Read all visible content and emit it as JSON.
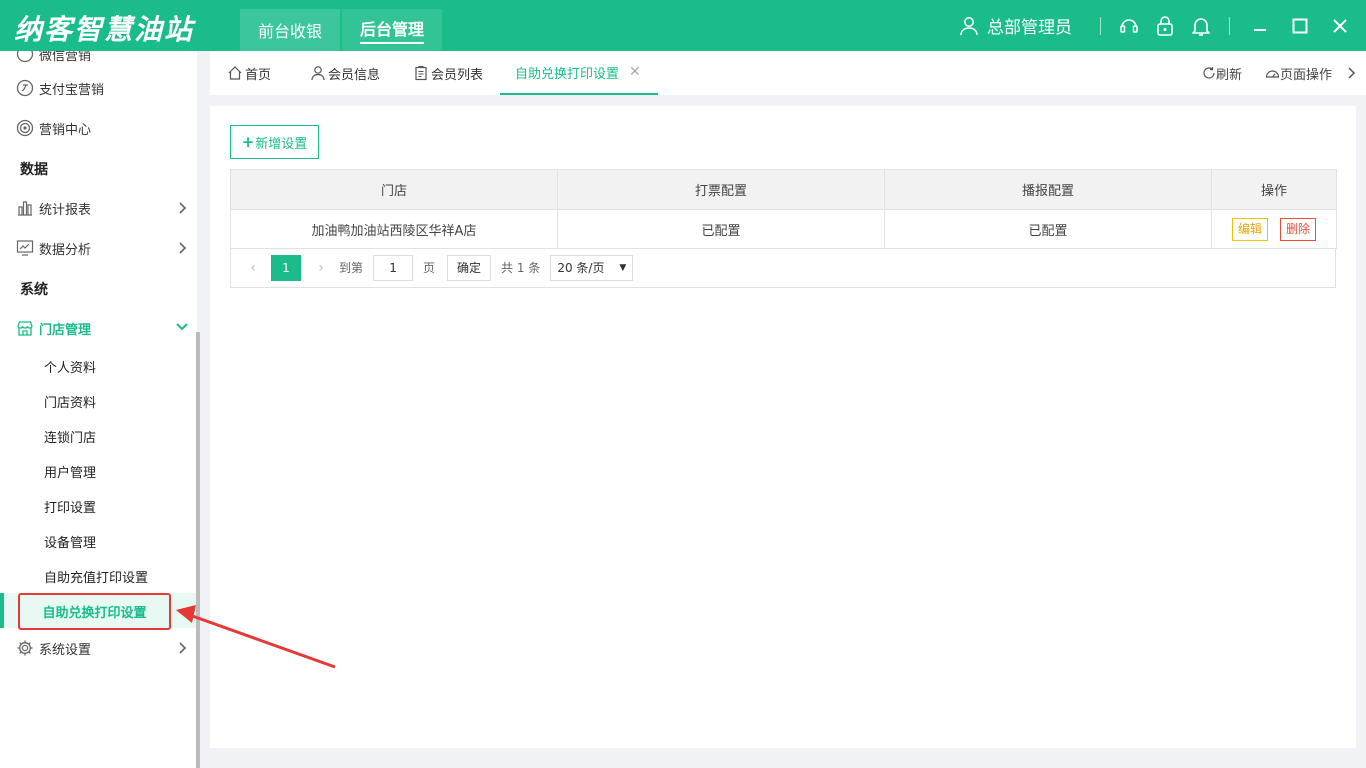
{
  "app": {
    "logo": "纳客智慧油站",
    "top_nav": [
      "前台收银",
      "后台管理"
    ],
    "active_top_nav": "后台管理",
    "user": "总部管理员"
  },
  "sidebar": {
    "partial_item": "微信营销",
    "items": [
      {
        "label": "支付宝营销",
        "icon": "alipay-icon"
      },
      {
        "label": "营销中心",
        "icon": "target-icon"
      }
    ],
    "section_data": "数据",
    "data_items": [
      {
        "label": "统计报表",
        "icon": "bar-chart-icon"
      },
      {
        "label": "数据分析",
        "icon": "line-chart-icon"
      }
    ],
    "section_system": "系统",
    "store_menu": {
      "label": "门店管理",
      "icon": "store-icon"
    },
    "sub_items": [
      "个人资料",
      "门店资料",
      "连锁门店",
      "用户管理",
      "打印设置",
      "设备管理",
      "自助充值打印设置",
      "自助兑换打印设置"
    ],
    "active_sub_item": "自助兑换打印设置",
    "system_settings": {
      "label": "系统设置",
      "icon": "gear-icon"
    }
  },
  "tabs": [
    {
      "label": "首页",
      "icon": "home-icon"
    },
    {
      "label": "会员信息",
      "icon": "user-icon"
    },
    {
      "label": "会员列表",
      "icon": "clipboard-icon"
    },
    {
      "label": "自助兑换打印设置",
      "active": true,
      "closable": true
    }
  ],
  "tab_tools": {
    "refresh": "刷新",
    "page_ops": "页面操作"
  },
  "main": {
    "add_button": "新增设置",
    "table": {
      "columns": [
        "门店",
        "打票配置",
        "播报配置",
        "操作"
      ],
      "rows": [
        {
          "store": "加油鸭加油站西陵区华祥A店",
          "ticket_config": "已配置",
          "broadcast_config": "已配置",
          "actions": [
            "编辑",
            "删除"
          ]
        }
      ]
    },
    "pagination": {
      "current_page": "1",
      "goto_label": "到第",
      "goto_value": "1",
      "page_unit": "页",
      "confirm": "确定",
      "total": "共 1 条",
      "page_size": "20 条/页"
    }
  },
  "colors": {
    "brand": "#1abc8c",
    "annotation": "#e53935",
    "edit": "#e6a600",
    "delete": "#e74c3c"
  }
}
